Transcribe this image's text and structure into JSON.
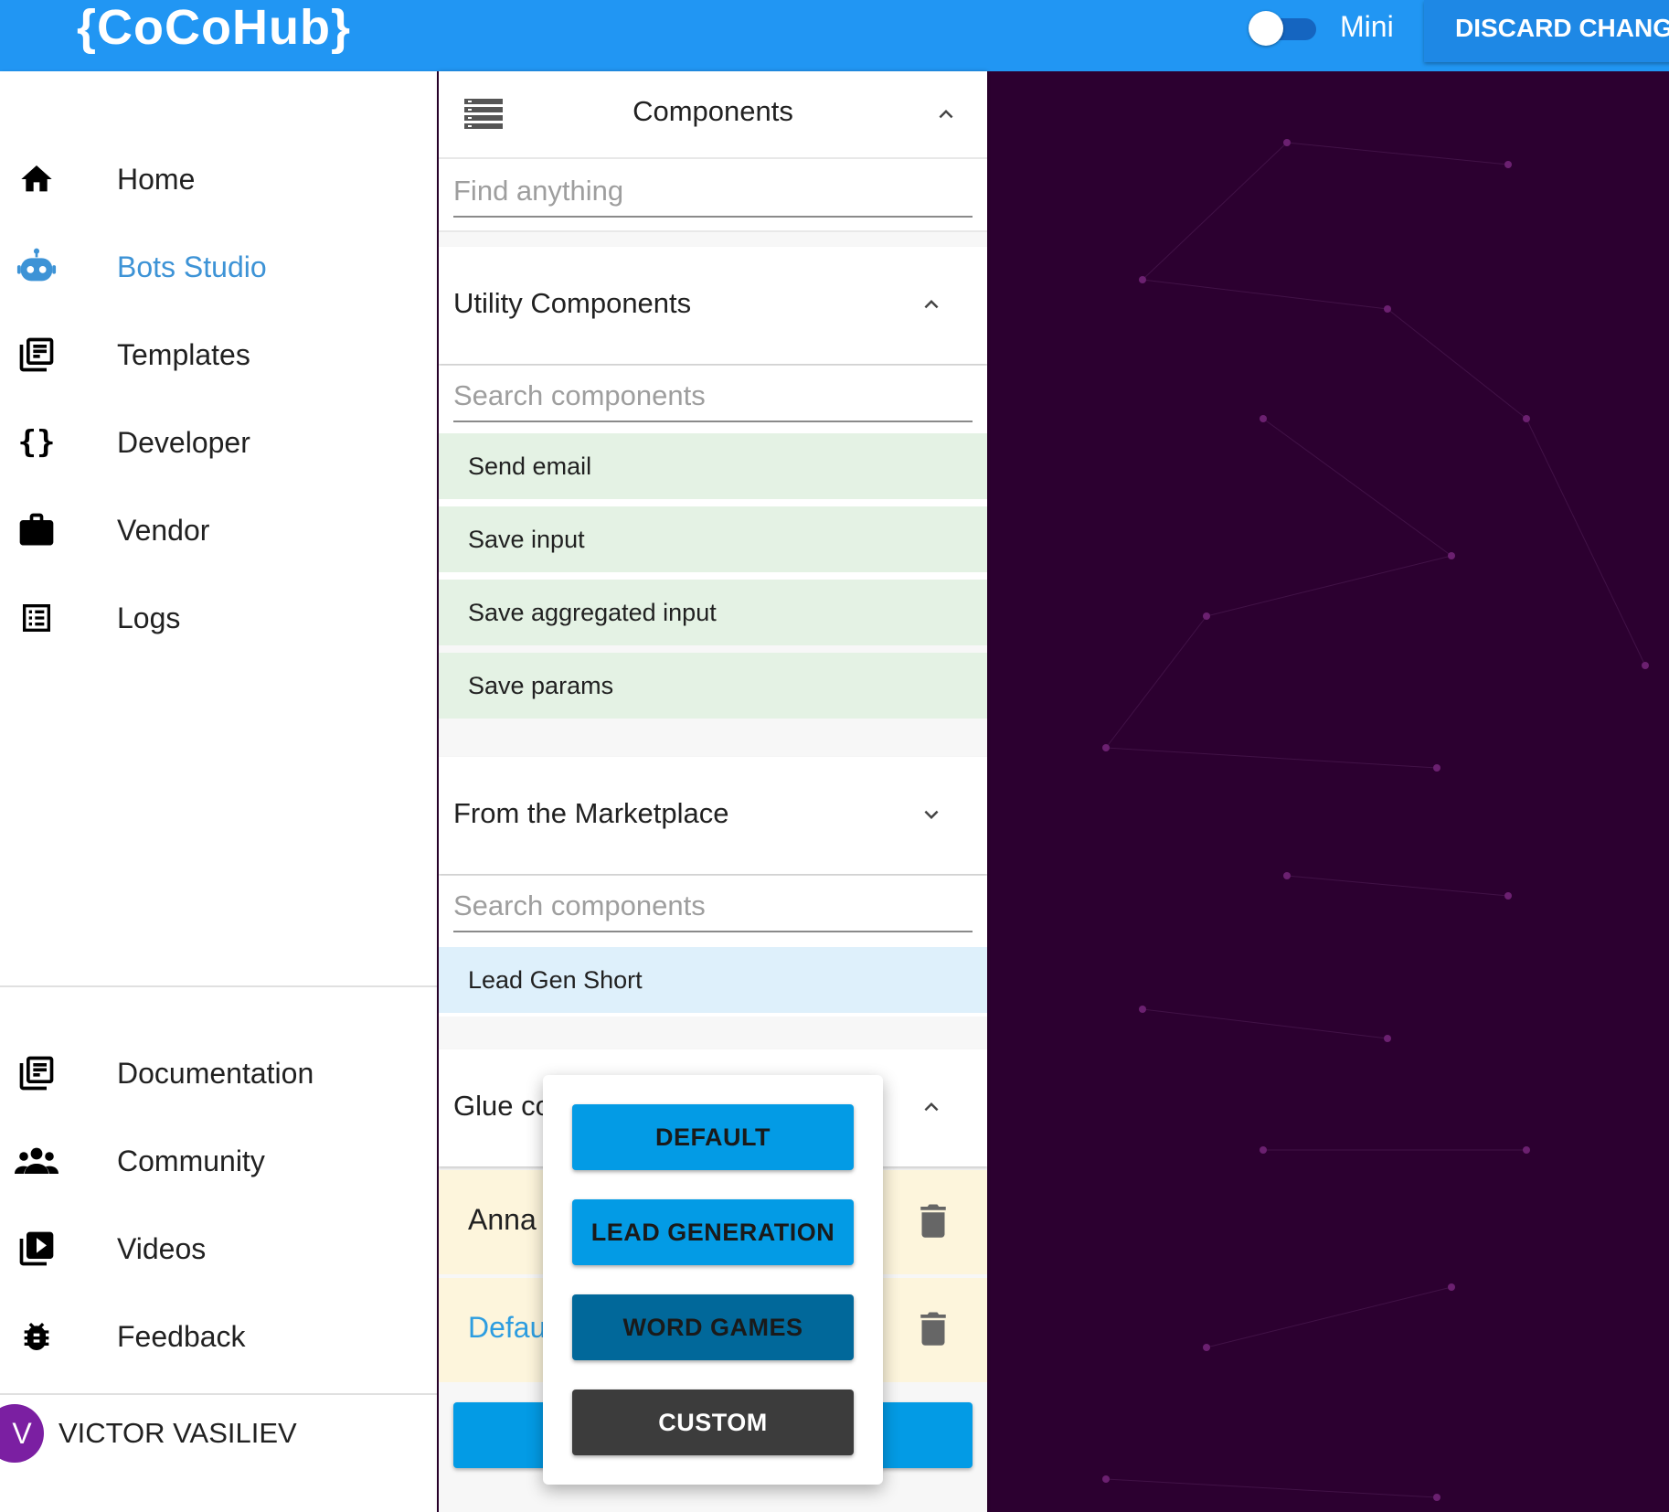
{
  "app": {
    "logo": "{CoCoHub}"
  },
  "topbar": {
    "mini_label": "Mini",
    "discard_label": "DISCARD CHANGE"
  },
  "sidebar": {
    "items": [
      {
        "label": "Home",
        "icon": "home-icon"
      },
      {
        "label": "Bots Studio",
        "icon": "robot-icon",
        "active": true
      },
      {
        "label": "Templates",
        "icon": "templates-icon"
      },
      {
        "label": "Developer",
        "icon": "braces-icon"
      },
      {
        "label": "Vendor",
        "icon": "briefcase-icon"
      },
      {
        "label": "Logs",
        "icon": "list-icon"
      }
    ],
    "bottom_items": [
      {
        "label": "Documentation",
        "icon": "documentation-icon"
      },
      {
        "label": "Community",
        "icon": "community-icon"
      },
      {
        "label": "Videos",
        "icon": "video-library-icon"
      },
      {
        "label": "Feedback",
        "icon": "bug-icon"
      }
    ],
    "user": {
      "initial": "V",
      "name": "VICTOR VASILIEV"
    }
  },
  "panel": {
    "title": "Components",
    "find_placeholder": "Find anything",
    "utility": {
      "title": "Utility Components",
      "search_placeholder": "Search components",
      "items": [
        "Send email",
        "Save input",
        "Save aggregated input",
        "Save params"
      ]
    },
    "marketplace": {
      "title": "From the Marketplace",
      "search_placeholder": "Search components",
      "items": [
        "Lead Gen Short"
      ]
    },
    "glue": {
      "title": "Glue co",
      "rows": [
        "Anna",
        "Defau"
      ]
    }
  },
  "popup": {
    "options": [
      "DEFAULT",
      "LEAD GENERATION",
      "WORD GAMES",
      "CUSTOM"
    ]
  },
  "colors": {
    "topbar": "#2196f3",
    "active_nav": "#3d93d6",
    "canvas_bg": "#2c0030",
    "utility_item_bg": "#e4f2e4",
    "marketplace_item_bg": "#def0fb",
    "glue_row_bg": "#fdf5dc",
    "button_blue": "#039be5"
  }
}
